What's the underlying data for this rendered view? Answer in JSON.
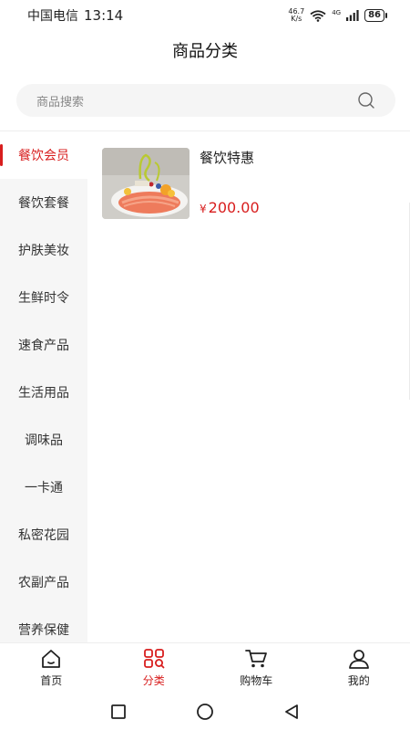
{
  "status_bar": {
    "carrier": "中国电信",
    "time": "13:14",
    "net_speed_value": "46.7",
    "net_speed_unit": "K/s",
    "network": "4G",
    "battery": "86"
  },
  "header": {
    "title": "商品分类"
  },
  "search": {
    "placeholder": "商品搜索"
  },
  "sidebar": {
    "items": [
      {
        "label": "餐饮会员",
        "active": true
      },
      {
        "label": "餐饮套餐"
      },
      {
        "label": "护肤美妆"
      },
      {
        "label": "生鲜时令"
      },
      {
        "label": "速食产品"
      },
      {
        "label": "生活用品"
      },
      {
        "label": "调味品"
      },
      {
        "label": "一卡通"
      },
      {
        "label": "私密花园"
      },
      {
        "label": "农副产品"
      },
      {
        "label": "营养保健"
      }
    ]
  },
  "products": [
    {
      "name": "餐饮特惠",
      "currency": "¥",
      "price": "200.00"
    }
  ],
  "tabbar": {
    "items": [
      {
        "label": "首页",
        "icon": "home-icon"
      },
      {
        "label": "分类",
        "icon": "category-icon",
        "active": true
      },
      {
        "label": "购物车",
        "icon": "cart-icon"
      },
      {
        "label": "我的",
        "icon": "user-icon"
      }
    ]
  },
  "colors": {
    "accent": "#d81e1e",
    "sidebar_bg": "#f6f6f6",
    "search_bg": "#f5f5f5"
  }
}
